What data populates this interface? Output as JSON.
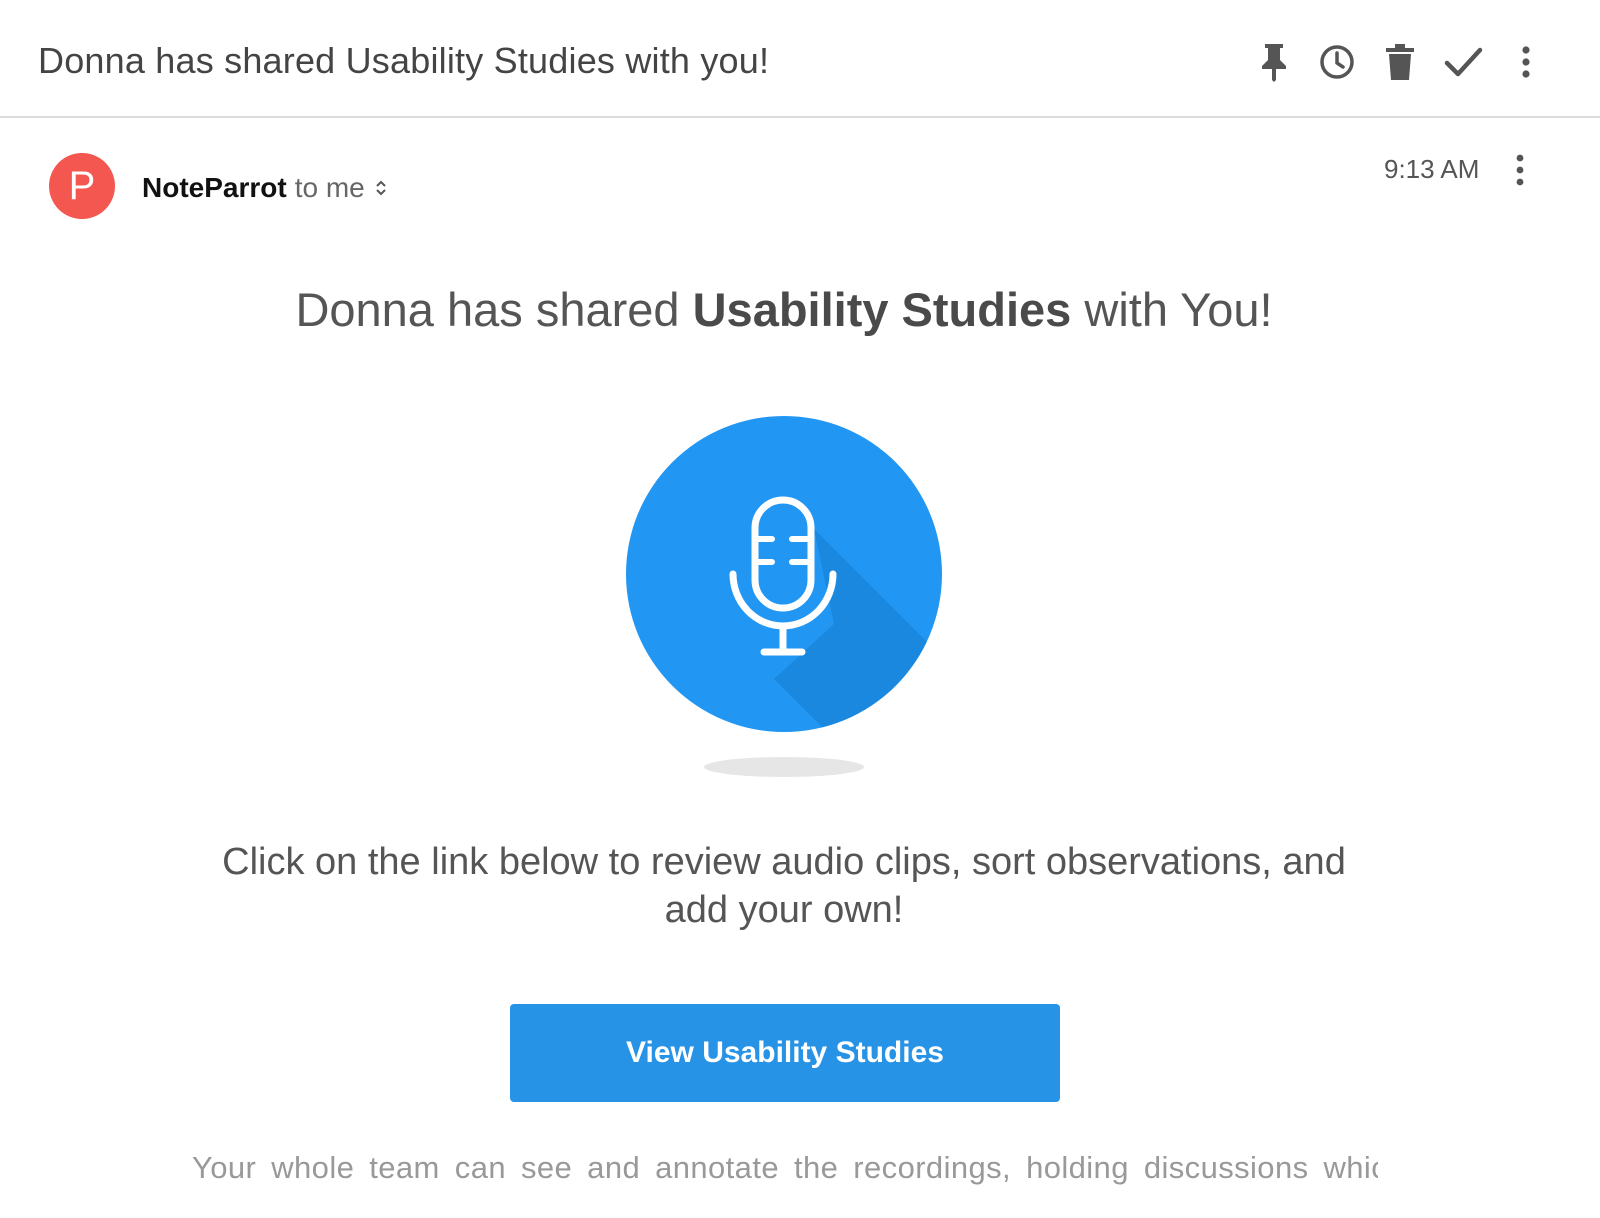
{
  "email": {
    "subject": "Donna has shared Usability Studies with you!",
    "sender": {
      "avatar_letter": "P",
      "avatar_color": "#f4574f",
      "name": "NoteParrot",
      "recipient": "to me"
    },
    "time": "9:13 AM"
  },
  "toolbar": {
    "icons": [
      "pin-icon",
      "snooze-clock-icon",
      "trash-icon",
      "check-icon",
      "more-vertical-icon"
    ]
  },
  "body": {
    "headline_prefix": "Donna has shared ",
    "headline_bold": "Usability Studies",
    "headline_suffix": " with You!",
    "illustration_icon": "microphone-icon",
    "description": "Click on the link below to review audio clips, sort observations, and add your own!",
    "cta_label": "View Usability Studies",
    "footer_partial": "Your whole team can see and annotate the recordings, holding discussions which"
  },
  "colors": {
    "accent": "#2793e6",
    "mic_circle": "#2196f3",
    "avatar": "#f4574f"
  }
}
